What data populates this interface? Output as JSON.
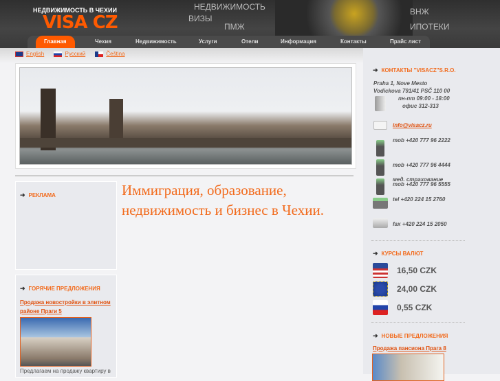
{
  "header": {
    "tagline": "НЕДВИЖИМОСТЬ В ЧЕХИИ",
    "logo": "VISA CZ",
    "words": [
      "НЕДВИЖИМОСТЬ",
      "ВИЗЫ",
      "ПМЖ",
      "ВНЖ",
      "ИПОТЕКИ"
    ]
  },
  "nav": [
    "Главная",
    "Чехия",
    "Недвижимость",
    "Услуги",
    "Отели",
    "Информация",
    "Контакты",
    "Прайс лист"
  ],
  "langs": [
    "English",
    "Русский",
    "Čeština"
  ],
  "headline": "Иммиграция, образование, недвижимость и бизнес в Чехии.",
  "ads": {
    "title": "РЕКЛАМА"
  },
  "hot": {
    "title": "ГОРЯЧИЕ ПРЕДЛОЖЕНИЯ",
    "link": "Продажа новостройки в элитном районе Праги 5",
    "text": "Предлагаем на продажу квартиру в"
  },
  "contacts": {
    "title": "КОНТАКТЫ \"VISACZ\"S.R.O.",
    "address1": "Praha 1,  Nove Mesto",
    "address2": "Vodickova 791/41 PSČ  110 00",
    "hours": "пн-пт 09:00 - 18:00",
    "office": "офис 312-313",
    "email": "info@visacz.ru",
    "mob1": "mob  +420 777 96 2222",
    "mob2": "mob  +420 777 96 4444",
    "med": "мед. страхование",
    "mob3": "mob  +420 777 96 5555",
    "tel": "tel     +420 224 15 2760",
    "fax": "fax    +420 224 15 2050"
  },
  "rates": {
    "title": "КУРСЫ ВАЛЮТ",
    "items": [
      {
        "currency": "USD",
        "value": "16,50 CZK"
      },
      {
        "currency": "EUR",
        "value": "24,00 CZK"
      },
      {
        "currency": "RUB",
        "value": "0,55 CZK"
      }
    ]
  },
  "new_offers": {
    "title": "НОВЫЕ ПРЕДЛОЖЕНИЯ",
    "link": "Продажа пансиона Прага 8"
  },
  "colors": {
    "accent": "#f26b1d",
    "header": "#3a3a3a"
  }
}
